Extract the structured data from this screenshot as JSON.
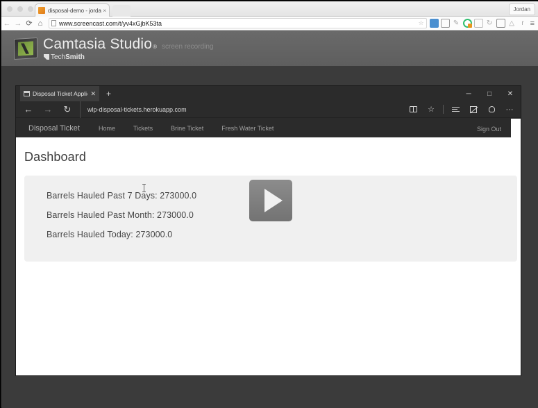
{
  "outer_browser": {
    "tab": {
      "title": "disposal-demo - jordanda",
      "close_label": "×",
      "favicon_name": "screencast-favicon"
    },
    "new_tab_label": "",
    "profile_label": "Jordan",
    "nav": {
      "back": "←",
      "forward": "→",
      "reload": "⟳",
      "home": "⌂"
    },
    "omnibox": {
      "url_domain": "www.screencast.com",
      "url_path": "/t/yv4xGjbK53ta",
      "full_url": "www.screencast.com/t/yv4xGjbK53ta",
      "bookmark_star": "☆"
    },
    "extensions": [
      {
        "name": "extension-blue-icon",
        "glyph": "■"
      },
      {
        "name": "extension-screen-icon",
        "glyph": ""
      },
      {
        "name": "extension-pen-icon",
        "glyph": ""
      },
      {
        "name": "extension-green-record-icon",
        "glyph": ""
      },
      {
        "name": "extension-grey-box-icon",
        "glyph": ""
      },
      {
        "name": "extension-refresh-icon",
        "glyph": "↺"
      },
      {
        "name": "extension-dark-box-icon",
        "glyph": ""
      },
      {
        "name": "extension-drop-icon",
        "glyph": "△"
      },
      {
        "name": "extension-r-icon",
        "glyph": "r"
      }
    ],
    "menu_glyph": "≡"
  },
  "camtasia": {
    "title": "Camtasia Studio",
    "registered_mark": "®",
    "tagline": "screen recording",
    "brand_prefix": "Tech",
    "brand_suffix": "Smith",
    "brand_tm": "®"
  },
  "edge_browser": {
    "tab": {
      "title": "Disposal Ticket Applicat",
      "close_label": "✕"
    },
    "new_tab_label": "+",
    "window_controls": {
      "minimize": "─",
      "maximize": "□",
      "close": "✕"
    },
    "nav": {
      "back": "←",
      "forward": "→",
      "refresh": "↻"
    },
    "address": "wlp-disposal-tickets.herokuapp.com",
    "tools": [
      {
        "name": "reading-view-icon"
      },
      {
        "name": "favorites-star-icon",
        "glyph": "☆"
      },
      {
        "name": "hub-lines-icon"
      },
      {
        "name": "web-note-icon"
      },
      {
        "name": "share-bell-icon"
      },
      {
        "name": "more-settings-icon",
        "glyph": "···"
      }
    ]
  },
  "app": {
    "brand": "Disposal Ticket",
    "nav_links": [
      {
        "label": "Home"
      },
      {
        "label": "Tickets"
      },
      {
        "label": "Brine Ticket"
      },
      {
        "label": "Fresh Water Ticket"
      }
    ],
    "sign_out": "Sign Out",
    "page_title": "Dashboard",
    "stats": [
      {
        "label": "Barrels Hauled Past 7 Days",
        "value": "273000.0",
        "text": "Barrels Hauled Past 7 Days: 273000.0"
      },
      {
        "label": "Barrels Hauled Past Month",
        "value": "273000.0",
        "text": "Barrels Hauled Past Month: 273000.0"
      },
      {
        "label": "Barrels Hauled Today",
        "value": "273000.0",
        "text": "Barrels Hauled Today: 273000.0"
      }
    ],
    "play_button_label": "Play"
  },
  "colors": {
    "camtasia_banner": "#6a6a6a",
    "camtasia_body": "#3b3b3b",
    "edge_chrome": "#2b2b2b",
    "app_navbar": "#2b2b2b",
    "jumbotron": "#f0f0f0",
    "play_button": "#7f7f7f",
    "record_accent": "#2fbf6f"
  }
}
